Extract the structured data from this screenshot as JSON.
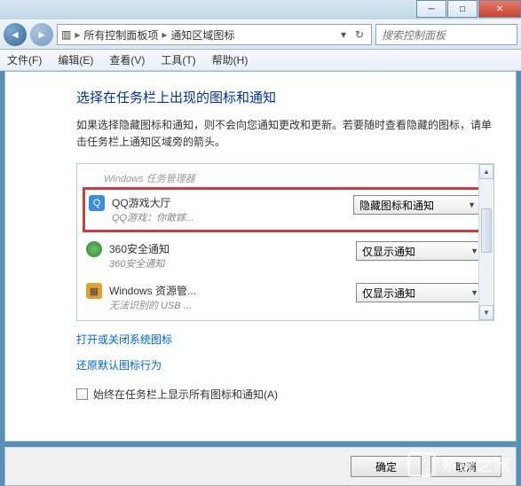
{
  "window": {
    "min": "─",
    "max": "□",
    "close": "✕"
  },
  "breadcrumb": {
    "icon": "▥",
    "part1": "所有控制面板项",
    "part2": "通知区域图标",
    "sep": "▸"
  },
  "search": {
    "placeholder": "搜索控制面板"
  },
  "menu": {
    "file": "文件(F)",
    "edit": "编辑(E)",
    "view": "查看(V)",
    "tools": "工具(T)",
    "help": "帮助(H)"
  },
  "page": {
    "title": "选择在任务栏上出现的图标和通知",
    "desc": "如果选择隐藏图标和通知，则不会向您通知更改和更新。若要随时查看隐藏的图标，请单击任务栏上通知区域旁的箭头。"
  },
  "items": [
    {
      "name": "Windows 任务管理器",
      "sub": "",
      "combo": "",
      "truncated": true
    },
    {
      "name": "QQ游戏大厅",
      "sub": "QQ游戏：你敢嫁...",
      "combo": "隐藏图标和通知",
      "highlight": true
    },
    {
      "name": "360安全通知",
      "sub": "360安全通知",
      "combo": "仅显示通知"
    },
    {
      "name": "Windows 资源管...",
      "sub": "无法识别的 USB ...",
      "combo": "仅显示通知"
    }
  ],
  "links": {
    "toggle_system": "打开或关闭系统图标",
    "restore_default": "还原默认图标行为"
  },
  "checkbox": {
    "label": "始终在任务栏上显示所有图标和通知(A)"
  },
  "buttons": {
    "ok": "确定",
    "cancel": "取消"
  },
  "watermark": "系统之家"
}
